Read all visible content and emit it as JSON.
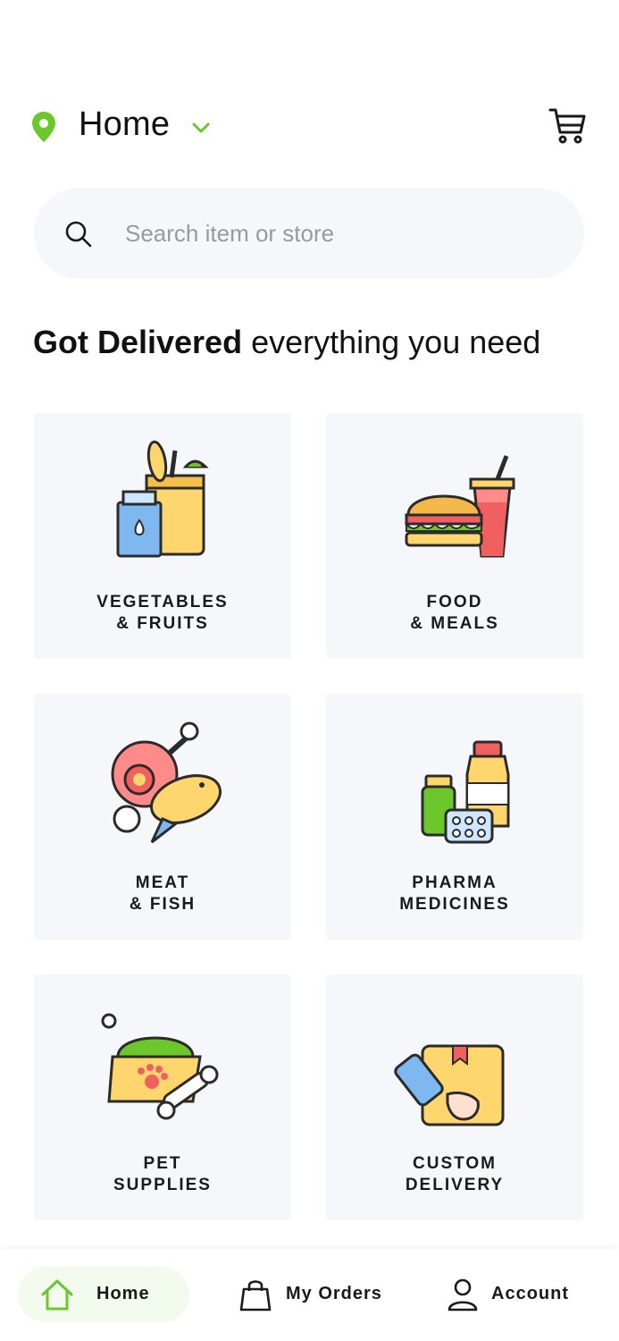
{
  "header": {
    "location_label": "Home",
    "location_icon": "map-pin-icon",
    "dropdown_icon": "chevron-down-icon",
    "cart_icon": "cart-icon",
    "accent_color": "#6cc72b"
  },
  "search": {
    "placeholder": "Search item or store",
    "value": "",
    "icon": "search-icon"
  },
  "headline": {
    "bold": "Got Delivered",
    "regular": " everything you need"
  },
  "categories": [
    {
      "line1": "VEGETABLES",
      "line2": "& FRUITS",
      "icon": "grocery-bag-icon"
    },
    {
      "line1": "FOOD",
      "line2": "& MEALS",
      "icon": "burger-drink-icon"
    },
    {
      "line1": "MEAT",
      "line2": "& FISH",
      "icon": "meat-fish-icon"
    },
    {
      "line1": "PHARMA",
      "line2": "MEDICINES",
      "icon": "medicine-bottles-icon"
    },
    {
      "line1": "PET",
      "line2": "SUPPLIES",
      "icon": "pet-food-bowl-icon"
    },
    {
      "line1": "CUSTOM",
      "line2": "DELIVERY",
      "icon": "package-hand-icon"
    }
  ],
  "bottom_nav": {
    "items": [
      {
        "label": "Home",
        "icon": "home-icon",
        "active": true
      },
      {
        "label": "My Orders",
        "icon": "shopping-bag-icon",
        "active": false
      },
      {
        "label": "Account",
        "icon": "user-icon",
        "active": false
      }
    ]
  }
}
